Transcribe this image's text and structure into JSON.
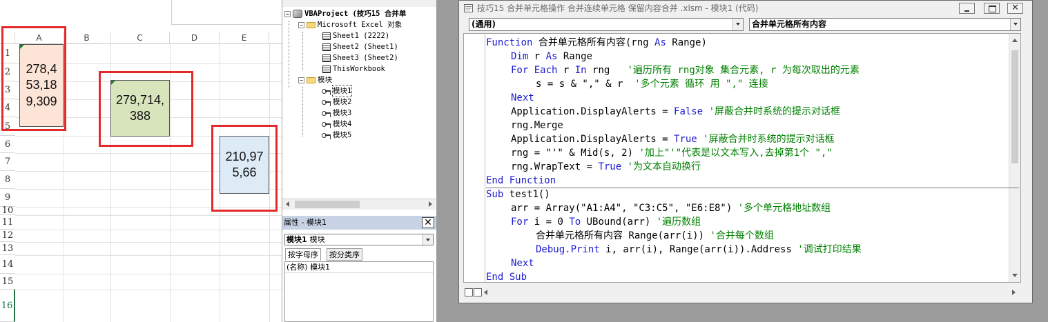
{
  "excel": {
    "columns": [
      "A",
      "B",
      "C",
      "D",
      "E"
    ],
    "rows": [
      "1",
      "2",
      "3",
      "4",
      "5",
      "6",
      "7",
      "8",
      "9",
      "10",
      "11",
      "12",
      "13",
      "14",
      "15",
      "16"
    ],
    "merged_cells": [
      {
        "range": "A1:A4",
        "text": "278,4\n53,18\n9,309",
        "fill": "#fce4d6"
      },
      {
        "range": "C3:C5",
        "text": "279,714,\n388",
        "fill": "#d8e4bc"
      },
      {
        "range": "E6:E8",
        "text": "210,97\n5,66",
        "fill": "#ddebf7"
      }
    ],
    "highlight_color": "#e4292b"
  },
  "project": {
    "root": "VBAProject (技巧15  合并单",
    "excel_objects_folder": "Microsoft Excel 对象",
    "sheets": [
      "Sheet1 (2222)",
      "Sheet2 (Sheet1)",
      "Sheet3 (Sheet2)",
      "ThisWorkbook"
    ],
    "modules_folder": "模块",
    "modules": [
      "模块1",
      "模块2",
      "模块3",
      "模块4",
      "模块5"
    ]
  },
  "properties": {
    "title": "属性 - 模块1",
    "close": "✕",
    "object_name": "模块1",
    "object_type": "模块",
    "tabs": [
      "按字母序",
      "按分类序"
    ],
    "rows": [
      {
        "name": "(名称)",
        "value": "模块1"
      }
    ]
  },
  "code_window": {
    "title": "技巧15  合并单元格操作  合并连续单元格  保留内容合并  .xlsm - 模块1 (代码)",
    "object_combo": "(通用)",
    "proc_combo": "合并单元格所有内容",
    "lines": [
      {
        "indent": 0,
        "tokens": [
          {
            "t": "Function",
            "k": "kw"
          },
          {
            "t": " 合并单元格所有内容(rng "
          },
          {
            "t": "As",
            "k": "kw"
          },
          {
            "t": " Range)"
          }
        ]
      },
      {
        "indent": 1,
        "tokens": [
          {
            "t": "Dim",
            "k": "kw"
          },
          {
            "t": " r "
          },
          {
            "t": "As",
            "k": "kw"
          },
          {
            "t": " Range"
          }
        ]
      },
      {
        "indent": 1,
        "tokens": [
          {
            "t": "For Each",
            "k": "kw"
          },
          {
            "t": " r "
          },
          {
            "t": "In",
            "k": "kw"
          },
          {
            "t": " rng   "
          },
          {
            "t": "'遍历所有 rng对象 集合元素, r 为每次取出的元素",
            "k": "cm"
          }
        ]
      },
      {
        "indent": 2,
        "tokens": [
          {
            "t": "s = s & \",\" & r  "
          },
          {
            "t": "'多个元素 循环 用 \",\" 连接",
            "k": "cm"
          }
        ]
      },
      {
        "indent": 1,
        "tokens": [
          {
            "t": "Next",
            "k": "kw"
          }
        ]
      },
      {
        "indent": 1,
        "tokens": [
          {
            "t": "Application.DisplayAlerts = "
          },
          {
            "t": "False",
            "k": "kw"
          },
          {
            "t": " "
          },
          {
            "t": "'屏蔽合并时系统的提示对话框",
            "k": "cm"
          }
        ]
      },
      {
        "indent": 1,
        "tokens": [
          {
            "t": "rng.Merge"
          }
        ]
      },
      {
        "indent": 1,
        "tokens": [
          {
            "t": "Application.DisplayAlerts = "
          },
          {
            "t": "True",
            "k": "kw"
          },
          {
            "t": " "
          },
          {
            "t": "'屏蔽合并时系统的提示对话框",
            "k": "cm"
          }
        ]
      },
      {
        "indent": 1,
        "tokens": [
          {
            "t": "rng = \"'\" & Mid(s, 2) "
          },
          {
            "t": "'加上\"'\"代表是以文本写入,去掉第1个 \",\"",
            "k": "cm"
          }
        ]
      },
      {
        "indent": 1,
        "tokens": [
          {
            "t": "rng.WrapText = "
          },
          {
            "t": "True",
            "k": "kw"
          },
          {
            "t": " "
          },
          {
            "t": "'为文本自动换行",
            "k": "cm"
          }
        ]
      },
      {
        "indent": 0,
        "tokens": [
          {
            "t": "End Function",
            "k": "kw"
          }
        ],
        "separator_after": true
      },
      {
        "indent": 0,
        "tokens": [
          {
            "t": "Sub",
            "k": "kw"
          },
          {
            "t": " test1()"
          }
        ]
      },
      {
        "indent": 1,
        "tokens": [
          {
            "t": "arr = Array(\"A1:A4\", \"C3:C5\", \"E6:E8\") "
          },
          {
            "t": "'多个单元格地址数组",
            "k": "cm"
          }
        ]
      },
      {
        "indent": 1,
        "tokens": [
          {
            "t": "For",
            "k": "kw"
          },
          {
            "t": " i = 0 "
          },
          {
            "t": "To",
            "k": "kw"
          },
          {
            "t": " UBound(arr) "
          },
          {
            "t": "'遍历数组",
            "k": "cm"
          }
        ]
      },
      {
        "indent": 2,
        "tokens": [
          {
            "t": "合并单元格所有内容 Range(arr(i)) "
          },
          {
            "t": "'合并每个数组",
            "k": "cm"
          }
        ]
      },
      {
        "indent": 2,
        "tokens": [
          {
            "t": "Debug.Print",
            "k": "kw"
          },
          {
            "t": " i, arr(i), Range(arr(i)).Address "
          },
          {
            "t": "'调试打印结果",
            "k": "cm"
          }
        ]
      },
      {
        "indent": 1,
        "tokens": [
          {
            "t": "Next",
            "k": "kw"
          }
        ]
      },
      {
        "indent": 0,
        "tokens": [
          {
            "t": "End Sub",
            "k": "kw"
          }
        ]
      }
    ]
  }
}
